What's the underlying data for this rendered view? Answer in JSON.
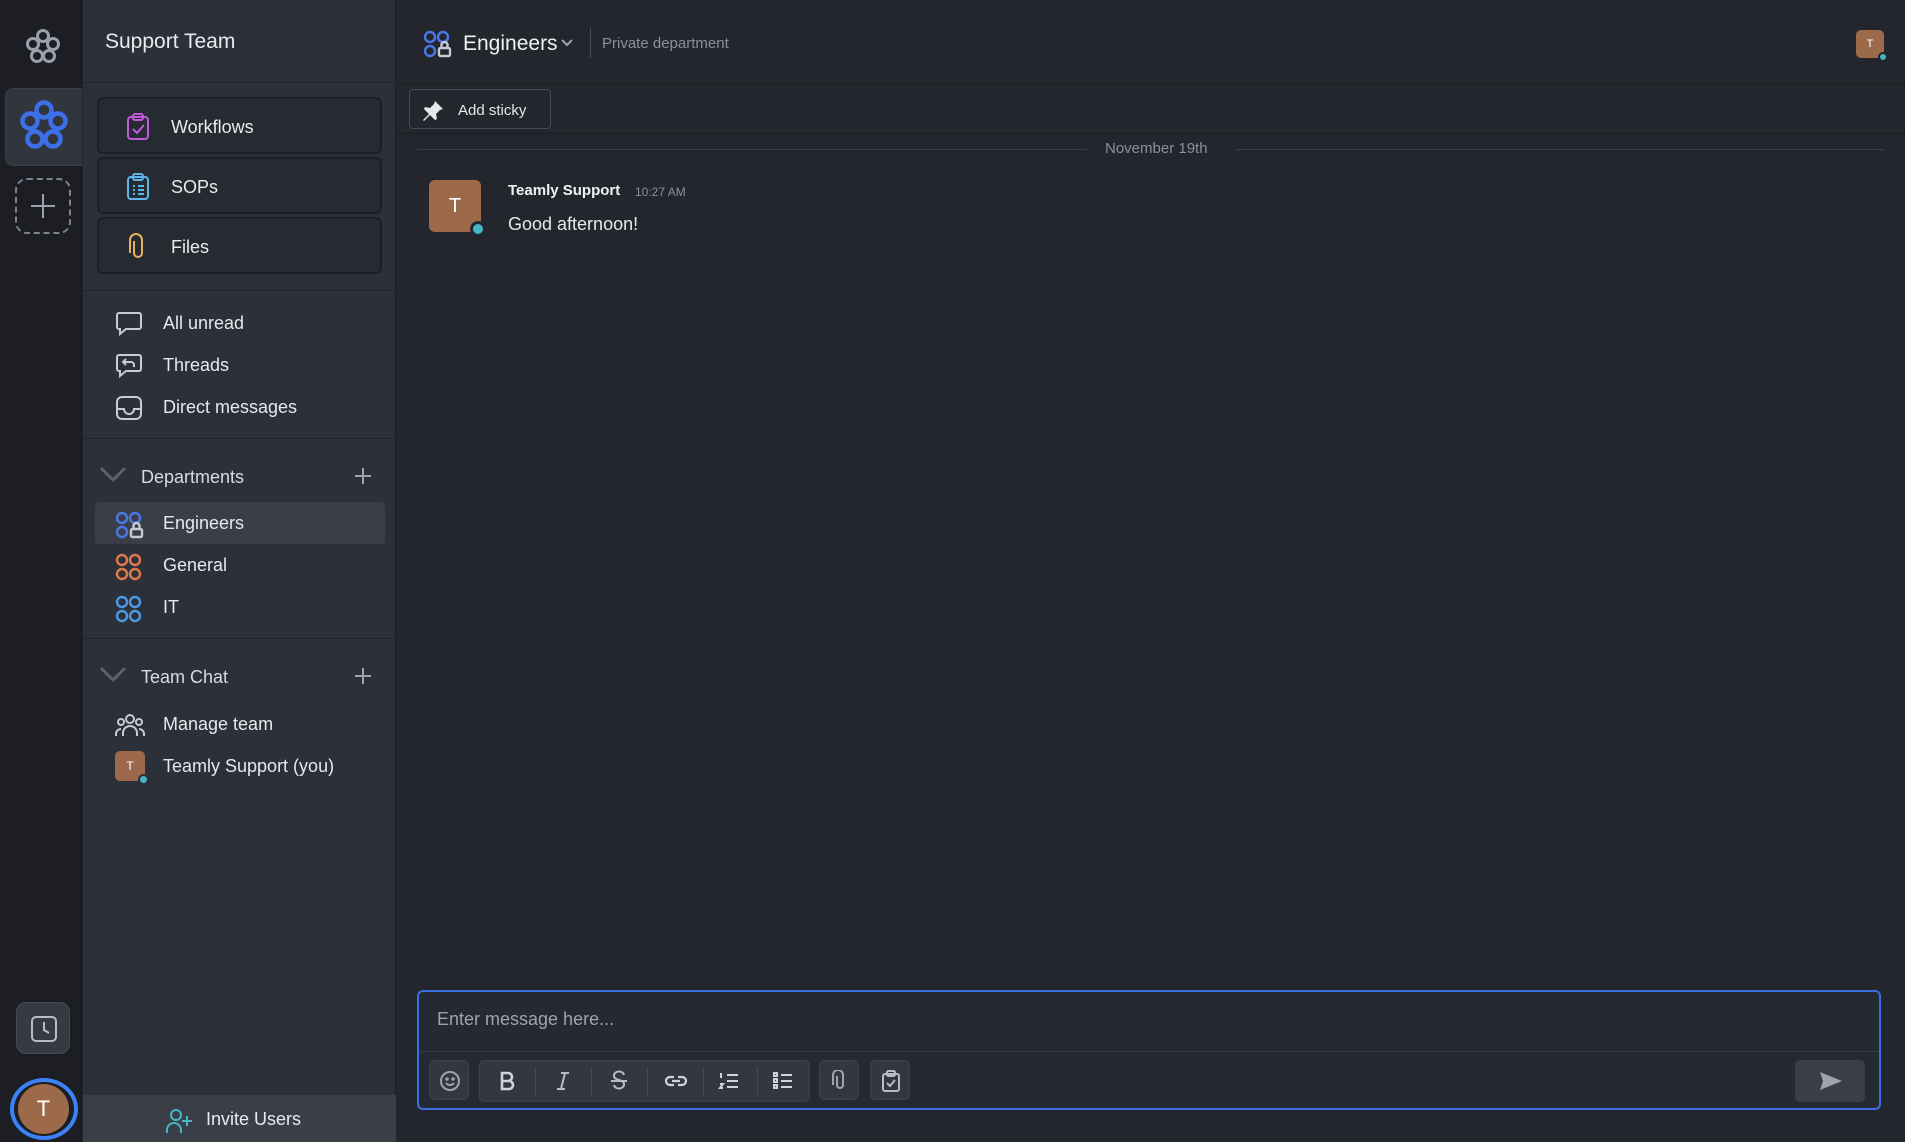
{
  "workspace": {
    "name": "Support Team"
  },
  "rail": {
    "user_initial": "T"
  },
  "sidebar": {
    "cards": [
      {
        "label": "Workflows",
        "icon": "clipboard-check-icon",
        "color": "#c05ad8"
      },
      {
        "label": "SOPs",
        "icon": "clipboard-list-icon",
        "color": "#5fb6e8"
      },
      {
        "label": "Files",
        "icon": "paperclip-icon",
        "color": "#e8b15a"
      }
    ],
    "nav": [
      {
        "label": "All unread",
        "icon": "chat-bubble-icon"
      },
      {
        "label": "Threads",
        "icon": "threads-icon"
      },
      {
        "label": "Direct messages",
        "icon": "inbox-icon"
      }
    ],
    "departments": {
      "title": "Departments",
      "items": [
        {
          "label": "Engineers",
          "icon": "private-department-icon",
          "color": "#4a78e8",
          "active": true
        },
        {
          "label": "General",
          "icon": "department-icon",
          "color": "#e07a4a"
        },
        {
          "label": "IT",
          "icon": "department-icon",
          "color": "#4a9ae8"
        }
      ]
    },
    "team_chat": {
      "title": "Team Chat",
      "items": [
        {
          "label": "Manage team",
          "icon": "team-icon"
        },
        {
          "label": "Teamly Support (you)",
          "avatar_initial": "T"
        }
      ]
    },
    "invite_label": "Invite Users"
  },
  "header": {
    "title": "Engineers",
    "subtitle": "Private department",
    "user_initial": "T"
  },
  "toolbar": {
    "add_sticky": "Add sticky"
  },
  "messages": {
    "date_divider": "November 19th",
    "items": [
      {
        "author": "Teamly Support",
        "time": "10:27 AM",
        "text": "Good afternoon!",
        "avatar_initial": "T"
      }
    ]
  },
  "composer": {
    "placeholder": "Enter message here...",
    "tools": [
      "emoji-icon",
      "bold-icon",
      "italic-icon",
      "strikethrough-icon",
      "link-icon",
      "ordered-list-icon",
      "bullet-list-icon",
      "attach-icon",
      "task-icon",
      "send-icon"
    ]
  },
  "colors": {
    "accent": "#3b82f6",
    "avatar": "#9c6a4a",
    "online": "#45b5c4"
  }
}
